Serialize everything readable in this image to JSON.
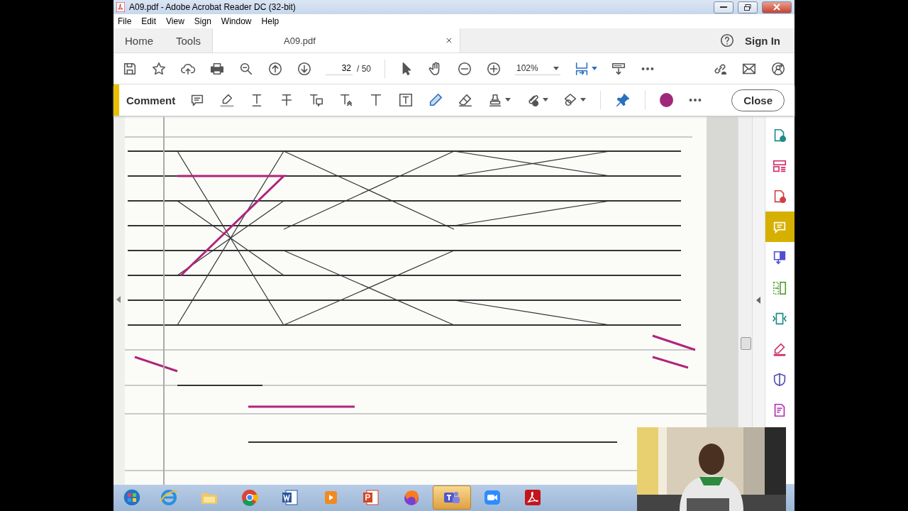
{
  "window": {
    "title": "A09.pdf - Adobe Acrobat Reader DC (32-bit)"
  },
  "menu": [
    "File",
    "Edit",
    "View",
    "Sign",
    "Window",
    "Help"
  ],
  "tabs": [
    {
      "label": "Home",
      "kind": "nav",
      "selected": false
    },
    {
      "label": "Tools",
      "kind": "nav",
      "selected": false
    },
    {
      "label": "A09.pdf",
      "kind": "document",
      "selected": true
    }
  ],
  "sign_in": "Sign In",
  "toolbar": {
    "page": "32",
    "page_total": "/ 50",
    "zoom": "102%"
  },
  "comment_bar": {
    "label": "Comment",
    "close": "Close"
  },
  "tools_panel": [
    {
      "selected": false
    },
    {
      "selected": false
    },
    {
      "selected": false
    },
    {
      "selected": true
    },
    {
      "selected": false
    },
    {
      "selected": false
    },
    {
      "selected": false
    },
    {
      "selected": false
    },
    {
      "selected": false
    },
    {
      "selected": false
    }
  ],
  "taskbar": [
    {
      "selected": false
    },
    {
      "selected": false
    },
    {
      "selected": false
    },
    {
      "selected": false
    },
    {
      "selected": false
    },
    {
      "selected": false
    },
    {
      "selected": false
    },
    {
      "selected": false
    },
    {
      "selected": true
    },
    {
      "selected": false
    },
    {
      "selected": false
    }
  ]
}
